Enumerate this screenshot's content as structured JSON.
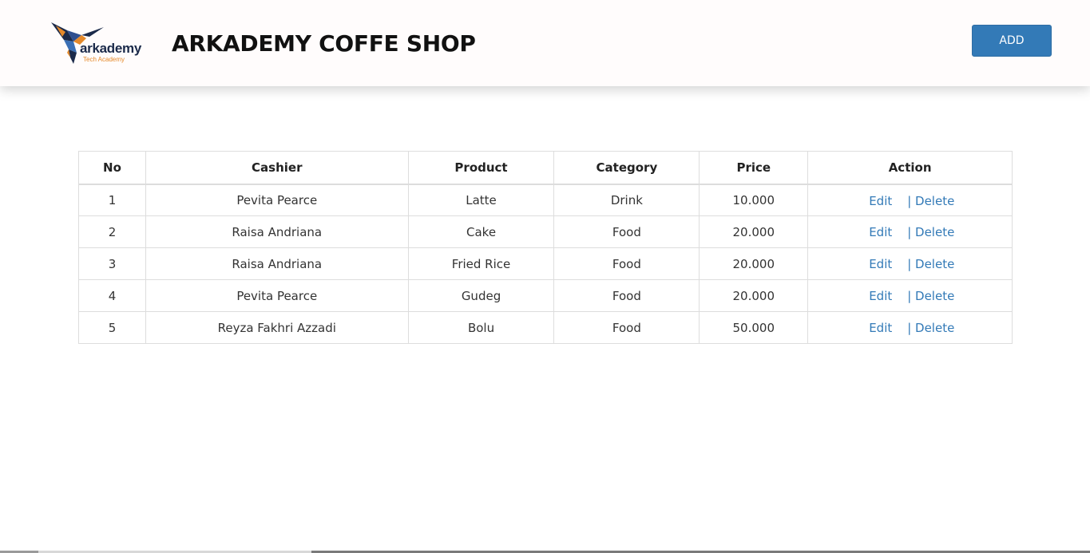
{
  "header": {
    "logo_word": "arkademy",
    "logo_tagline": "Tech Academy",
    "title": "ARKADEMY COFFE SHOP",
    "add_label": "ADD"
  },
  "colors": {
    "accent": "#337ab7",
    "logo_navy": "#1b2a4a",
    "logo_orange": "#e5892a"
  },
  "table": {
    "headers": [
      "No",
      "Cashier",
      "Product",
      "Category",
      "Price",
      "Action"
    ],
    "rows": [
      {
        "no": "1",
        "cashier": "Pevita Pearce",
        "product": "Latte",
        "category": "Drink",
        "price": "10.000",
        "edit": "Edit",
        "delete": "| Delete"
      },
      {
        "no": "2",
        "cashier": "Raisa Andriana",
        "product": "Cake",
        "category": "Food",
        "price": "20.000",
        "edit": "Edit",
        "delete": "| Delete"
      },
      {
        "no": "3",
        "cashier": "Raisa Andriana",
        "product": "Fried Rice",
        "category": "Food",
        "price": "20.000",
        "edit": "Edit",
        "delete": "| Delete"
      },
      {
        "no": "4",
        "cashier": "Pevita Pearce",
        "product": "Gudeg",
        "category": "Food",
        "price": "20.000",
        "edit": "Edit",
        "delete": "| Delete"
      },
      {
        "no": "5",
        "cashier": "Reyza Fakhri Azzadi",
        "product": "Bolu",
        "category": "Food",
        "price": "50.000",
        "edit": "Edit",
        "delete": "| Delete"
      }
    ]
  }
}
